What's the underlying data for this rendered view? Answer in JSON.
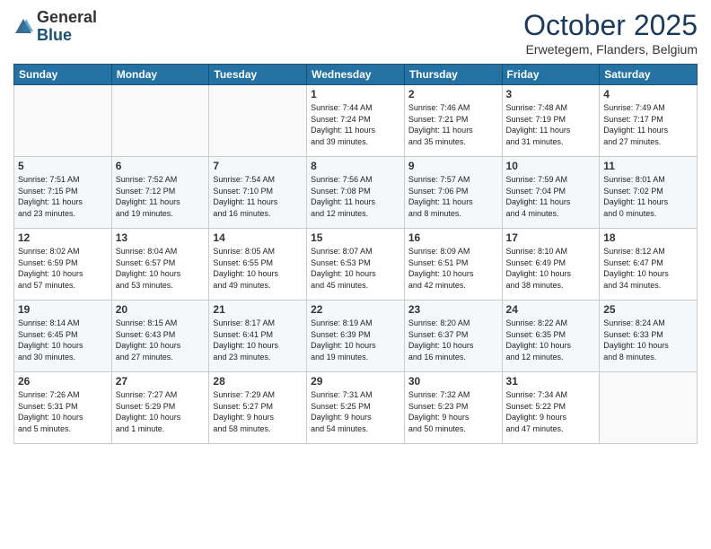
{
  "header": {
    "logo_general": "General",
    "logo_blue": "Blue",
    "month": "October 2025",
    "location": "Erwetegem, Flanders, Belgium"
  },
  "days_of_week": [
    "Sunday",
    "Monday",
    "Tuesday",
    "Wednesday",
    "Thursday",
    "Friday",
    "Saturday"
  ],
  "weeks": [
    [
      {
        "day": "",
        "info": ""
      },
      {
        "day": "",
        "info": ""
      },
      {
        "day": "",
        "info": ""
      },
      {
        "day": "1",
        "info": "Sunrise: 7:44 AM\nSunset: 7:24 PM\nDaylight: 11 hours\nand 39 minutes."
      },
      {
        "day": "2",
        "info": "Sunrise: 7:46 AM\nSunset: 7:21 PM\nDaylight: 11 hours\nand 35 minutes."
      },
      {
        "day": "3",
        "info": "Sunrise: 7:48 AM\nSunset: 7:19 PM\nDaylight: 11 hours\nand 31 minutes."
      },
      {
        "day": "4",
        "info": "Sunrise: 7:49 AM\nSunset: 7:17 PM\nDaylight: 11 hours\nand 27 minutes."
      }
    ],
    [
      {
        "day": "5",
        "info": "Sunrise: 7:51 AM\nSunset: 7:15 PM\nDaylight: 11 hours\nand 23 minutes."
      },
      {
        "day": "6",
        "info": "Sunrise: 7:52 AM\nSunset: 7:12 PM\nDaylight: 11 hours\nand 19 minutes."
      },
      {
        "day": "7",
        "info": "Sunrise: 7:54 AM\nSunset: 7:10 PM\nDaylight: 11 hours\nand 16 minutes."
      },
      {
        "day": "8",
        "info": "Sunrise: 7:56 AM\nSunset: 7:08 PM\nDaylight: 11 hours\nand 12 minutes."
      },
      {
        "day": "9",
        "info": "Sunrise: 7:57 AM\nSunset: 7:06 PM\nDaylight: 11 hours\nand 8 minutes."
      },
      {
        "day": "10",
        "info": "Sunrise: 7:59 AM\nSunset: 7:04 PM\nDaylight: 11 hours\nand 4 minutes."
      },
      {
        "day": "11",
        "info": "Sunrise: 8:01 AM\nSunset: 7:02 PM\nDaylight: 11 hours\nand 0 minutes."
      }
    ],
    [
      {
        "day": "12",
        "info": "Sunrise: 8:02 AM\nSunset: 6:59 PM\nDaylight: 10 hours\nand 57 minutes."
      },
      {
        "day": "13",
        "info": "Sunrise: 8:04 AM\nSunset: 6:57 PM\nDaylight: 10 hours\nand 53 minutes."
      },
      {
        "day": "14",
        "info": "Sunrise: 8:05 AM\nSunset: 6:55 PM\nDaylight: 10 hours\nand 49 minutes."
      },
      {
        "day": "15",
        "info": "Sunrise: 8:07 AM\nSunset: 6:53 PM\nDaylight: 10 hours\nand 45 minutes."
      },
      {
        "day": "16",
        "info": "Sunrise: 8:09 AM\nSunset: 6:51 PM\nDaylight: 10 hours\nand 42 minutes."
      },
      {
        "day": "17",
        "info": "Sunrise: 8:10 AM\nSunset: 6:49 PM\nDaylight: 10 hours\nand 38 minutes."
      },
      {
        "day": "18",
        "info": "Sunrise: 8:12 AM\nSunset: 6:47 PM\nDaylight: 10 hours\nand 34 minutes."
      }
    ],
    [
      {
        "day": "19",
        "info": "Sunrise: 8:14 AM\nSunset: 6:45 PM\nDaylight: 10 hours\nand 30 minutes."
      },
      {
        "day": "20",
        "info": "Sunrise: 8:15 AM\nSunset: 6:43 PM\nDaylight: 10 hours\nand 27 minutes."
      },
      {
        "day": "21",
        "info": "Sunrise: 8:17 AM\nSunset: 6:41 PM\nDaylight: 10 hours\nand 23 minutes."
      },
      {
        "day": "22",
        "info": "Sunrise: 8:19 AM\nSunset: 6:39 PM\nDaylight: 10 hours\nand 19 minutes."
      },
      {
        "day": "23",
        "info": "Sunrise: 8:20 AM\nSunset: 6:37 PM\nDaylight: 10 hours\nand 16 minutes."
      },
      {
        "day": "24",
        "info": "Sunrise: 8:22 AM\nSunset: 6:35 PM\nDaylight: 10 hours\nand 12 minutes."
      },
      {
        "day": "25",
        "info": "Sunrise: 8:24 AM\nSunset: 6:33 PM\nDaylight: 10 hours\nand 8 minutes."
      }
    ],
    [
      {
        "day": "26",
        "info": "Sunrise: 7:26 AM\nSunset: 5:31 PM\nDaylight: 10 hours\nand 5 minutes."
      },
      {
        "day": "27",
        "info": "Sunrise: 7:27 AM\nSunset: 5:29 PM\nDaylight: 10 hours\nand 1 minute."
      },
      {
        "day": "28",
        "info": "Sunrise: 7:29 AM\nSunset: 5:27 PM\nDaylight: 9 hours\nand 58 minutes."
      },
      {
        "day": "29",
        "info": "Sunrise: 7:31 AM\nSunset: 5:25 PM\nDaylight: 9 hours\nand 54 minutes."
      },
      {
        "day": "30",
        "info": "Sunrise: 7:32 AM\nSunset: 5:23 PM\nDaylight: 9 hours\nand 50 minutes."
      },
      {
        "day": "31",
        "info": "Sunrise: 7:34 AM\nSunset: 5:22 PM\nDaylight: 9 hours\nand 47 minutes."
      },
      {
        "day": "",
        "info": ""
      }
    ]
  ]
}
